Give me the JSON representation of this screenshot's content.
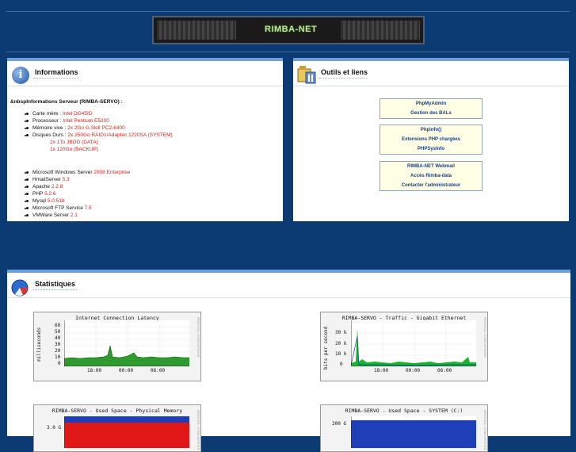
{
  "banner": {
    "logo_text": "RIMBA-NET"
  },
  "info": {
    "title": "Informations",
    "heading": "&nbspInformations Serveur (RIMBA-SERVO) :",
    "hardware": [
      {
        "label": "Carte mère : ",
        "value": "Intel DG45ID"
      },
      {
        "label": "Processeur : ",
        "value": "Intel Pentium E5200"
      },
      {
        "label": "Mémoire vive : ",
        "value": "2x 2Go G.Skill PC2-6400"
      },
      {
        "label": "Disques Durs : ",
        "value": "2x 250Go RAID1/Adaptec 1220SA (SYSTEM)"
      }
    ],
    "disks_extra": [
      "2x 1To JBOD (DATA)",
      "1x 120Go (BACKUP)"
    ],
    "software": [
      {
        "label": "Microsoft Windows Server ",
        "value": "2008 Enterprise"
      },
      {
        "label": "HmailServer ",
        "value": "5.3"
      },
      {
        "label": "Apache ",
        "value": "2.2.8"
      },
      {
        "label": "PHP ",
        "value": "5.2.6"
      },
      {
        "label": "Mysql ",
        "value": "5.0.51b"
      },
      {
        "label": "Microsoft FTP Service ",
        "value": "7.5"
      },
      {
        "label": "VMWare Server ",
        "value": "2.1"
      }
    ]
  },
  "tools": {
    "title": "Outils et liens",
    "groups": [
      [
        "PhpMyAdmin",
        "Gestion des BALs"
      ],
      [
        "Phpinfo()",
        "Extensions PHP chargées",
        "PHPSysInfo"
      ],
      [
        "RIMBA-NET Webmail",
        "Accès Rimba-data",
        "Contacter l'administrateur"
      ]
    ]
  },
  "stats": {
    "title": "Statistiques",
    "graphs": [
      {
        "title": "Internet Connection Latency",
        "ylabel": "milliseconds",
        "yticks": [
          "60",
          "50",
          "40",
          "30",
          "20",
          "10",
          "0"
        ],
        "xticks": [
          "18:00",
          "00:00",
          "06:00"
        ],
        "side": "RRDTOOL / TOBI OETIKER"
      },
      {
        "title": "RIMBA-SERVO - Traffic - Gigabit Ethernet",
        "ylabel": "bits per second",
        "yticks": [
          "30 k",
          "20 k",
          "10 k",
          "0"
        ],
        "xticks": [
          "18:00",
          "00:00",
          "06:00"
        ],
        "side": "RRDTOOL / TOBI OETIKER"
      },
      {
        "title": "RIMBA-SERVO - Used Space - Physical Memory",
        "yticks": [
          "3.0 G"
        ],
        "side": "RRDTOOL / TOBI OETIKER"
      },
      {
        "title": "RIMBA-SERVO - Used Space - SYSTEM (C:)",
        "yticks": [
          "200 G"
        ],
        "side": "RRDTOOL / TOBI OETIKER"
      }
    ]
  },
  "colors": {
    "background": "#0c3b74",
    "panel_border": "#6fa0d8",
    "value_red": "#d8201c",
    "link_blue": "#1a3f8a",
    "latency_green": "#2f9a2f",
    "traffic_green": "#17b52a",
    "memory_red": "#e01818",
    "memory_blue": "#1f3fb8"
  }
}
